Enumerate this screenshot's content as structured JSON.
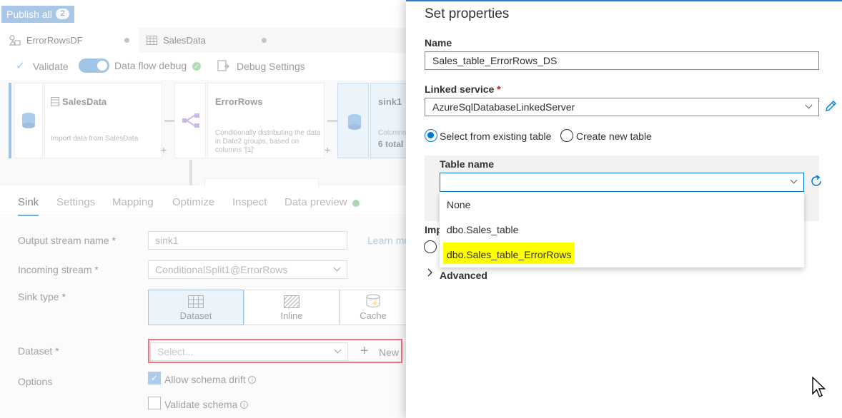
{
  "toolbar": {
    "publish_label": "Publish all",
    "publish_count": "2",
    "validate_label": "Validate",
    "debug_label": "Data flow debug",
    "debug_settings_label": "Debug Settings"
  },
  "doc_tabs": [
    {
      "label": "ErrorRowsDF"
    },
    {
      "label": "SalesData"
    }
  ],
  "canvas": {
    "nodes": [
      {
        "title": "SalesData",
        "subtitle": "Import data from SalesData"
      },
      {
        "title": "ErrorRows",
        "subtitle": "Conditionally distributing the data in Date2 groups, based on columns '[1]'"
      },
      {
        "title": "sink1",
        "subtitle": "Columns:",
        "detail": "6 total"
      }
    ]
  },
  "property_tabs": [
    "Sink",
    "Settings",
    "Mapping",
    "Optimize",
    "Inspect",
    "Data preview"
  ],
  "sink": {
    "output_stream_label": "Output stream name",
    "output_stream_value": "sink1",
    "learn_more": "Learn more",
    "incoming_stream_label": "Incoming stream",
    "incoming_stream_value": "ConditionalSplit1@ErrorRows",
    "sink_type_label": "Sink type",
    "sink_types": [
      "Dataset",
      "Inline",
      "Cache"
    ],
    "dataset_label": "Dataset",
    "dataset_placeholder": "Select...",
    "new_label": "New",
    "options_label": "Options",
    "allow_schema_drift": "Allow schema drift",
    "validate_schema": "Validate schema"
  },
  "panel": {
    "title": "Set properties",
    "name_label": "Name",
    "name_value": "Sales_table_ErrorRows_DS",
    "linked_service_label": "Linked service",
    "linked_service_value": "AzureSqlDatabaseLinkedServer",
    "radio_existing": "Select from existing table",
    "radio_new": "Create new table",
    "table_name_label": "Table name",
    "import_label_partial": "Imp",
    "advanced_label": "Advanced",
    "table_options": [
      "None",
      "dbo.Sales_table",
      "dbo.Sales_table_ErrorRows"
    ]
  },
  "colors": {
    "accent": "#0078d4",
    "highlight": "#ffff00",
    "error_border": "#e81123",
    "required": "#a4262c"
  }
}
